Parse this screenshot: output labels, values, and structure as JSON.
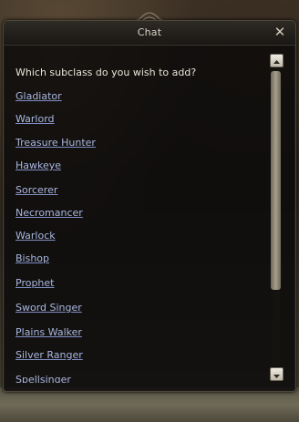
{
  "window": {
    "title": "Chat",
    "close_glyph": "✕"
  },
  "dialog": {
    "question": "Which subclass do you wish to add?",
    "options": [
      "Gladiator",
      "Warlord",
      "Treasure Hunter",
      "Hawkeye",
      "Sorcerer",
      "Necromancer",
      "Warlock",
      "Bishop",
      "Prophet",
      "Sword Singer",
      "Plains Walker",
      "Silver Ranger",
      "Spellsinger"
    ]
  },
  "scrollbar": {
    "up_icon": "arrow-up-icon",
    "down_icon": "arrow-down-icon"
  },
  "colors": {
    "link": "#a9b7e0",
    "text": "#e8e4d8",
    "title": "#d8d3c4"
  }
}
